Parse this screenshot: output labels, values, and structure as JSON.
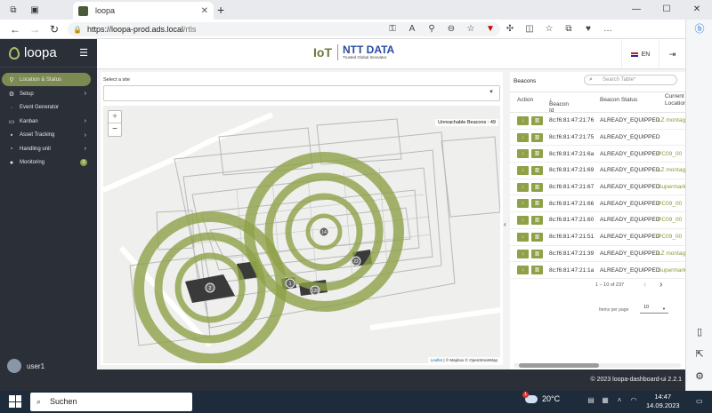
{
  "browser": {
    "tab_title": "loopa",
    "url": "https://loopa-prod.ads.local/rtls",
    "url_host_part": "https://loopa-prod.ads.local",
    "url_path_part": "/rtls"
  },
  "sidebar": {
    "app_name": "loopa",
    "items": [
      {
        "label": "Location & Status",
        "icon": "map-pin-icon",
        "chevron": false
      },
      {
        "label": "Setup",
        "icon": "gear-icon",
        "chevron": true
      },
      {
        "label": "Event Generator",
        "icon": "event-icon",
        "chevron": false
      },
      {
        "label": "Kanban",
        "icon": "kanban-icon",
        "chevron": true
      },
      {
        "label": "Asset Tracking",
        "icon": "tag-icon",
        "chevron": true
      },
      {
        "label": "Handling unit",
        "icon": "box-icon",
        "chevron": true
      },
      {
        "label": "Monitoring",
        "icon": "monitor-icon",
        "badge": "0"
      }
    ],
    "user_name": "user1"
  },
  "header": {
    "logo_iot": "IoT",
    "logo_ntt": "NTT DATA",
    "logo_tagline": "Trusted Global Innovator",
    "language": "EN"
  },
  "site_select": {
    "label": "Select a site",
    "value": ""
  },
  "map": {
    "zoom_in": "+",
    "zoom_out": "−",
    "unreachable_label": "Unreachable Beacons : 49",
    "markers": [
      "2",
      "14",
      "22",
      "1",
      "126"
    ],
    "attribution_leaflet": "Leaflet",
    "attribution_rest": "| © Mapbox © OpenStreetMap"
  },
  "beacons": {
    "title": "Beacons",
    "search_placeholder": "Search Table*",
    "columns": {
      "action": "Action",
      "beacon_id": "Beacon Id",
      "status": "Beacon Status",
      "location": "Current Location"
    },
    "rows": [
      {
        "id": "8c:f6:81:47:21:76",
        "status": "ALREADY_EQUIPPED",
        "location": "LZ montage"
      },
      {
        "id": "8c:f6:81:47:21:75",
        "status": "ALREADY_EQUIPPED",
        "location": ""
      },
      {
        "id": "8c:f6:81:47:21:6a",
        "status": "ALREADY_EQUIPPED",
        "location": "PC09_00"
      },
      {
        "id": "8c:f6:81:47:21:69",
        "status": "ALREADY_EQUIPPED",
        "location": "LZ montage"
      },
      {
        "id": "8c:f6:81:47:21:67",
        "status": "ALREADY_EQUIPPED",
        "location": "Supermarket"
      },
      {
        "id": "8c:f6:81:47:21:66",
        "status": "ALREADY_EQUIPPED",
        "location": "PC09_00"
      },
      {
        "id": "8c:f6:81:47:21:60",
        "status": "ALREADY_EQUIPPED",
        "location": "PC09_00"
      },
      {
        "id": "8c:f6:81:47:21:51",
        "status": "ALREADY_EQUIPPED",
        "location": "PC09_00"
      },
      {
        "id": "8c:f6:81:47:21:39",
        "status": "ALREADY_EQUIPPED",
        "location": "LZ montage"
      },
      {
        "id": "8c:f6:81:47:21:1a",
        "status": "ALREADY_EQUIPPED",
        "location": "Supermarket"
      }
    ],
    "pagination": "1 – 10 of 237",
    "items_per_page_label": "Items per page",
    "items_per_page": "10"
  },
  "footer": {
    "text": "© 2023 loopa-dashboard-ui 2.2.1"
  },
  "taskbar": {
    "search": "Suchen",
    "temperature": "20°C",
    "weather_badge": "1",
    "time": "14:47",
    "date": "14.09.2023"
  },
  "colors": {
    "accent": "#8ea147",
    "sidebar_bg": "#2b2f38",
    "active_item": "#7d8a52",
    "taskbar": "#1e2b3a"
  }
}
